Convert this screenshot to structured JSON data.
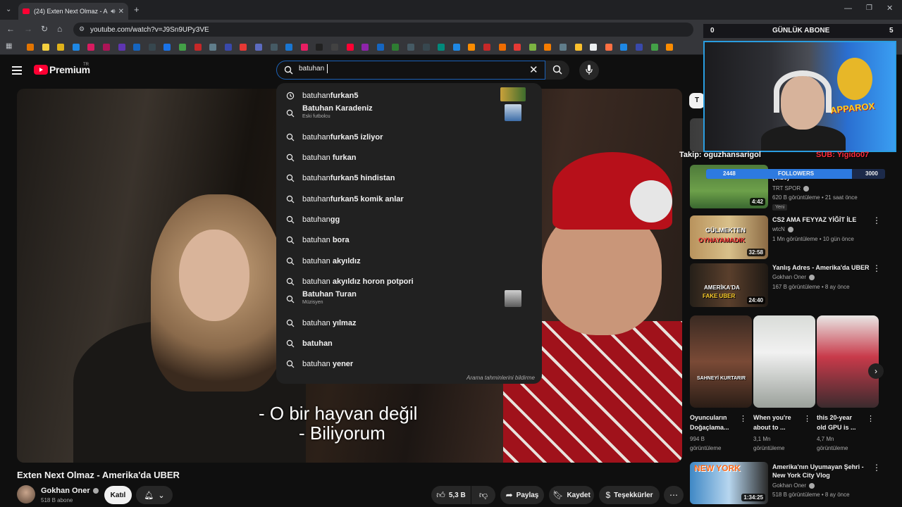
{
  "browser": {
    "tab_title": "(24) Exten Next Olmaz - Am",
    "url": "youtube.com/watch?v=J9Sn9UPy3VE"
  },
  "header": {
    "brand": "Premium",
    "region": "TR",
    "search_value": "batuhan"
  },
  "suggestions": [
    {
      "type": "history",
      "bold": "furkan5",
      "prefix": "batuhan",
      "sub": ""
    },
    {
      "type": "search",
      "bold": "",
      "prefix": "Batuhan Karadeniz",
      "sub": "Eski futbolcu"
    },
    {
      "type": "search",
      "bold": "furkan5 izliyor",
      "prefix": "batuhan",
      "sub": ""
    },
    {
      "type": "search",
      "bold": "furkan",
      "prefix": "batuhan ",
      "sub": ""
    },
    {
      "type": "search",
      "bold": "furkan5 hindistan",
      "prefix": "batuhan",
      "sub": ""
    },
    {
      "type": "search",
      "bold": "furkan5 komik anlar",
      "prefix": "batuhan",
      "sub": ""
    },
    {
      "type": "search",
      "bold": "gg",
      "prefix": "batuhan",
      "sub": ""
    },
    {
      "type": "search",
      "bold": "bora",
      "prefix": "batuhan ",
      "sub": ""
    },
    {
      "type": "search",
      "bold": "akyıldız",
      "prefix": "batuhan ",
      "sub": ""
    },
    {
      "type": "search",
      "bold": "akyıldız horon potpori",
      "prefix": "batuhan ",
      "sub": ""
    },
    {
      "type": "search",
      "bold": "",
      "prefix": "Batuhan Turan",
      "sub": "Müzisyen"
    },
    {
      "type": "search",
      "bold": "yılmaz",
      "prefix": "batuhan ",
      "sub": ""
    },
    {
      "type": "search",
      "bold": "",
      "prefix": "batuhan",
      "sub": ""
    },
    {
      "type": "search",
      "bold": "yener",
      "prefix": "batuhan ",
      "sub": ""
    }
  ],
  "report_predictions": "Arama tahminlerini bildirme",
  "video": {
    "subtitle_line1": "- O bir hayvan değil",
    "subtitle_line2": "- Biliyorum",
    "title": "Exten Next Olmaz - Amerika'da UBER",
    "channel": "Gokhan Oner",
    "subscribers": "518 B abone",
    "join": "Katıl",
    "likes": "5,3 B",
    "share": "Paylaş",
    "save": "Kaydet",
    "thanks": "Teşekkürler"
  },
  "related": [
    {
      "title_partial": "(5:26)",
      "channel": "TRT SPOR",
      "meta": "620 B görüntüleme • 21 saat önce",
      "duration": "4:42",
      "badge": "Yeni"
    },
    {
      "title": "CS2 AMA FEYYAZ YİĞİT İLE",
      "channel": "wtcN",
      "meta": "1 Mn görüntüleme • 10 gün önce",
      "duration": "32:58"
    },
    {
      "title": "Yanlış Adres - Amerika'da UBER",
      "channel": "Gokhan Oner",
      "meta": "167 B görüntüleme • 8 ay önce",
      "duration": "24:40"
    },
    {
      "title": "Amerika'nın Uyumayan Şehri - New York City Vlog",
      "channel": "Gokhan Oner",
      "meta": "518 B görüntüleme • 8 ay önce",
      "duration": "1:34:25"
    }
  ],
  "shorts": [
    {
      "title": "Oyuncuların Doğaçlama...",
      "views": "994 B",
      "views_unit": "görüntüleme"
    },
    {
      "title": "When you're about to ...",
      "views": "3,1 Mn",
      "views_unit": "görüntüleme"
    },
    {
      "title": "this 20-year old GPU is ...",
      "views": "4,7 Mn",
      "views_unit": "görüntüleme"
    }
  ],
  "overlay": {
    "left_count": "0",
    "daily_label": "GÜNLÜK ABONE",
    "right_count": "5",
    "follow_line": "Takip: oguzhansarigol",
    "sub_line": "SUB: Yigido07",
    "followers_label": "FOLLOWERS",
    "followers_current": "2448",
    "followers_goal": "3000",
    "followers_progress": 0.816,
    "brand": "APPAROX"
  },
  "colors": {
    "accent": "#ff0033",
    "search_border": "#1c62b9",
    "overlay_blue": "#2d7ae0"
  }
}
